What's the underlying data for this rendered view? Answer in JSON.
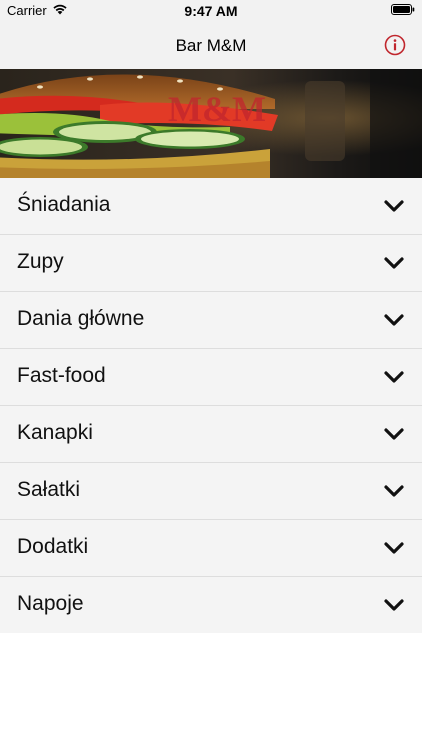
{
  "status_bar": {
    "carrier": "Carrier",
    "time": "9:47 AM"
  },
  "nav": {
    "title": "Bar M&M",
    "info_icon": "info-circle-icon"
  },
  "banner": {
    "logo_text": "M&M"
  },
  "menu": {
    "items": [
      {
        "label": "Śniadania"
      },
      {
        "label": "Zupy"
      },
      {
        "label": "Dania główne"
      },
      {
        "label": "Fast-food"
      },
      {
        "label": "Kanapki"
      },
      {
        "label": "Sałatki"
      },
      {
        "label": "Dodatki"
      },
      {
        "label": "Napoje"
      }
    ],
    "chevron_icon": "chevron-down-icon"
  },
  "colors": {
    "accent_red": "#c0262d",
    "bar_bg": "#f2f2f2",
    "row_bg": "#f4f4f4"
  }
}
